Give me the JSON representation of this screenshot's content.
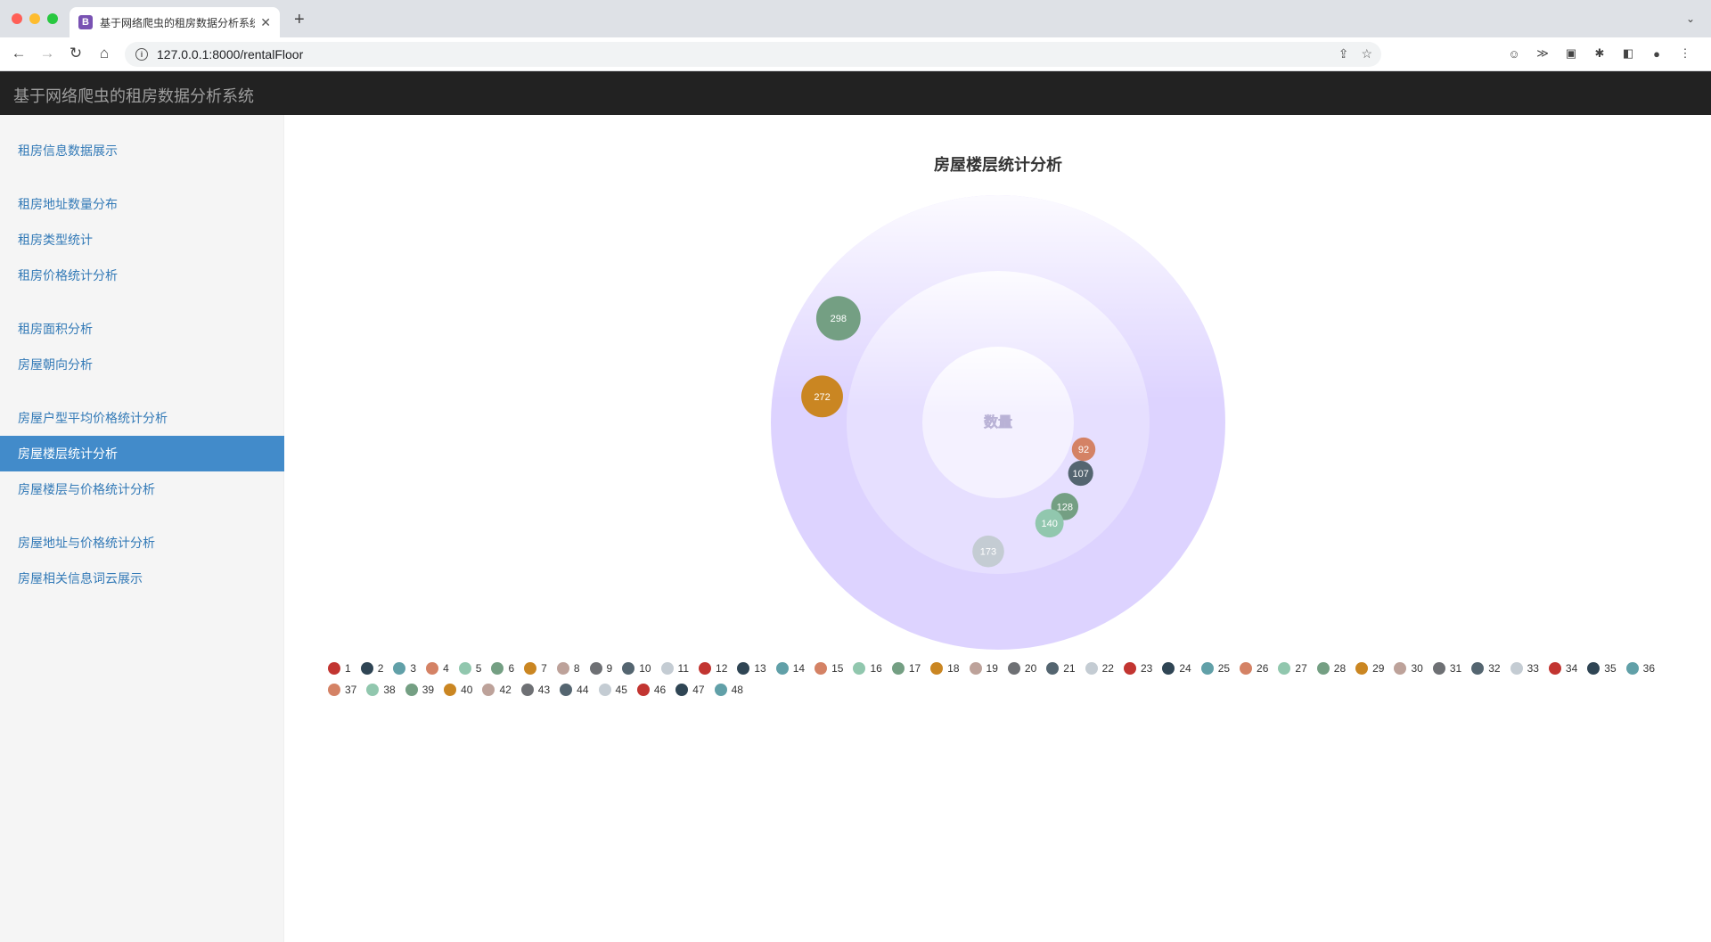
{
  "browser": {
    "tab_title": "基于网络爬虫的租房数据分析系统",
    "favicon_letter": "B",
    "url": "127.0.0.1:8000/rentalFloor"
  },
  "app": {
    "title": "基于网络爬虫的租房数据分析系统"
  },
  "sidebar": {
    "items": [
      {
        "label": "租房信息数据展示",
        "active": false
      },
      {
        "label": "租房地址数量分布",
        "active": false
      },
      {
        "label": "租房类型统计",
        "active": false
      },
      {
        "label": "租房价格统计分析",
        "active": false
      },
      {
        "label": "租房面积分析",
        "active": false
      },
      {
        "label": "房屋朝向分析",
        "active": false
      },
      {
        "label": "房屋户型平均价格统计分析",
        "active": false
      },
      {
        "label": "房屋楼层统计分析",
        "active": true
      },
      {
        "label": "房屋楼层与价格统计分析",
        "active": false
      },
      {
        "label": "房屋地址与价格统计分析",
        "active": false
      },
      {
        "label": "房屋相关信息词云展示",
        "active": false
      }
    ]
  },
  "chart_data": {
    "type": "scatter",
    "title": "房屋楼层统计分析",
    "center_label": "数量",
    "coordinate_system": "polar",
    "palette": [
      "#c23531",
      "#2f4554",
      "#61a0a8",
      "#d48265",
      "#91c7ae",
      "#749f83",
      "#ca8622",
      "#bda29a",
      "#6e7074",
      "#546570",
      "#c4ccd3"
    ],
    "legend": [
      "1",
      "2",
      "3",
      "4",
      "5",
      "6",
      "7",
      "8",
      "9",
      "10",
      "11",
      "12",
      "13",
      "14",
      "15",
      "16",
      "17",
      "18",
      "19",
      "20",
      "21",
      "22",
      "23",
      "24",
      "25",
      "26",
      "27",
      "28",
      "29",
      "30",
      "31",
      "32",
      "33",
      "34",
      "35",
      "36",
      "37",
      "38",
      "39",
      "40",
      "42",
      "43",
      "44",
      "45",
      "46",
      "47",
      "48"
    ],
    "labeled_points": [
      {
        "value": 298,
        "color": "#749f83"
      },
      {
        "value": 272,
        "color": "#ca8622"
      },
      {
        "value": 173,
        "color": "#c4ccd3"
      },
      {
        "value": 140,
        "color": "#91c7ae"
      },
      {
        "value": 128,
        "color": "#749f83"
      },
      {
        "value": 107,
        "color": "#546570"
      },
      {
        "value": 92,
        "color": "#d48265"
      }
    ]
  }
}
